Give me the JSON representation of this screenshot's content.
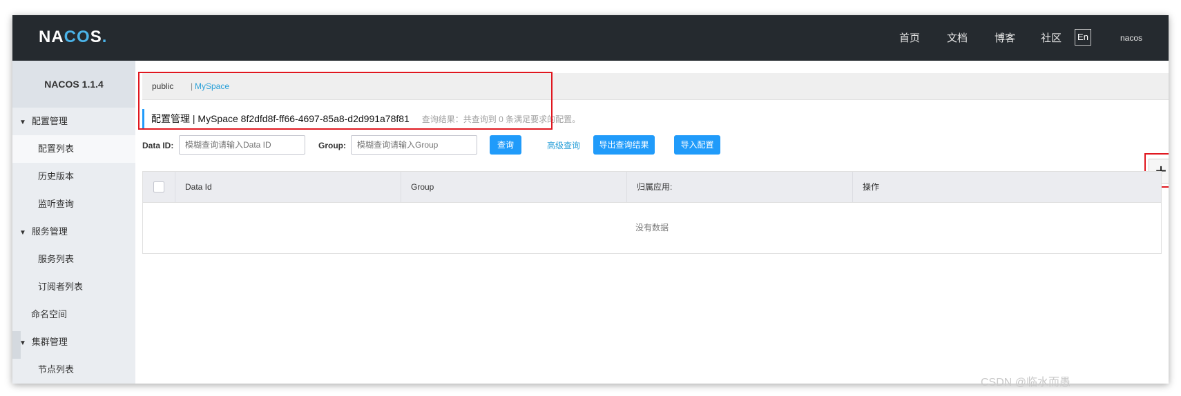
{
  "header": {
    "logo": {
      "n": "NA",
      "c": "C",
      "o": "O",
      "s": "S",
      "dot": "."
    },
    "nav": [
      "首页",
      "文档",
      "博客",
      "社区"
    ],
    "lang_button": "En",
    "user": "nacos"
  },
  "sidebar": {
    "title": "NACOS 1.1.4",
    "groups": [
      {
        "label": "配置管理",
        "items": [
          "配置列表",
          "历史版本",
          "监听查询"
        ]
      },
      {
        "label": "服务管理",
        "items": [
          "服务列表",
          "订阅者列表"
        ]
      },
      {
        "label": "命名空间"
      },
      {
        "label": "集群管理",
        "items": [
          "节点列表"
        ]
      }
    ],
    "active_item": "配置列表"
  },
  "namespace_bar": {
    "items": [
      "public",
      "MySpace"
    ],
    "separator": "|",
    "active": "MySpace"
  },
  "title": {
    "section": "配置管理",
    "sep": "|",
    "namespace": "MySpace",
    "namespace_id": "8f2dfd8f-ff66-4697-85a8-d2d991a78f81",
    "result_text": "查询结果：共查询到 0 条满足要求的配置。"
  },
  "filters": {
    "data_id_label": "Data ID:",
    "data_id_placeholder": "模糊查询请输入Data ID",
    "group_label": "Group:",
    "group_placeholder": "模糊查询请输入Group",
    "query_button": "查询",
    "advanced_link": "高级查询",
    "export_button": "导出查询结果",
    "import_button": "导入配置"
  },
  "add_button_icon": "plus-icon",
  "table": {
    "columns": [
      "Data Id",
      "Group",
      "归属应用:",
      "操作"
    ],
    "empty_text": "没有数据"
  },
  "watermark": "CSDN @临水而愚",
  "colors": {
    "topbar": "#252a2f",
    "sidebar": "#eaedf1",
    "primary": "#209bfa",
    "link": "#2aa0d8",
    "highlight": "#e0171f"
  }
}
